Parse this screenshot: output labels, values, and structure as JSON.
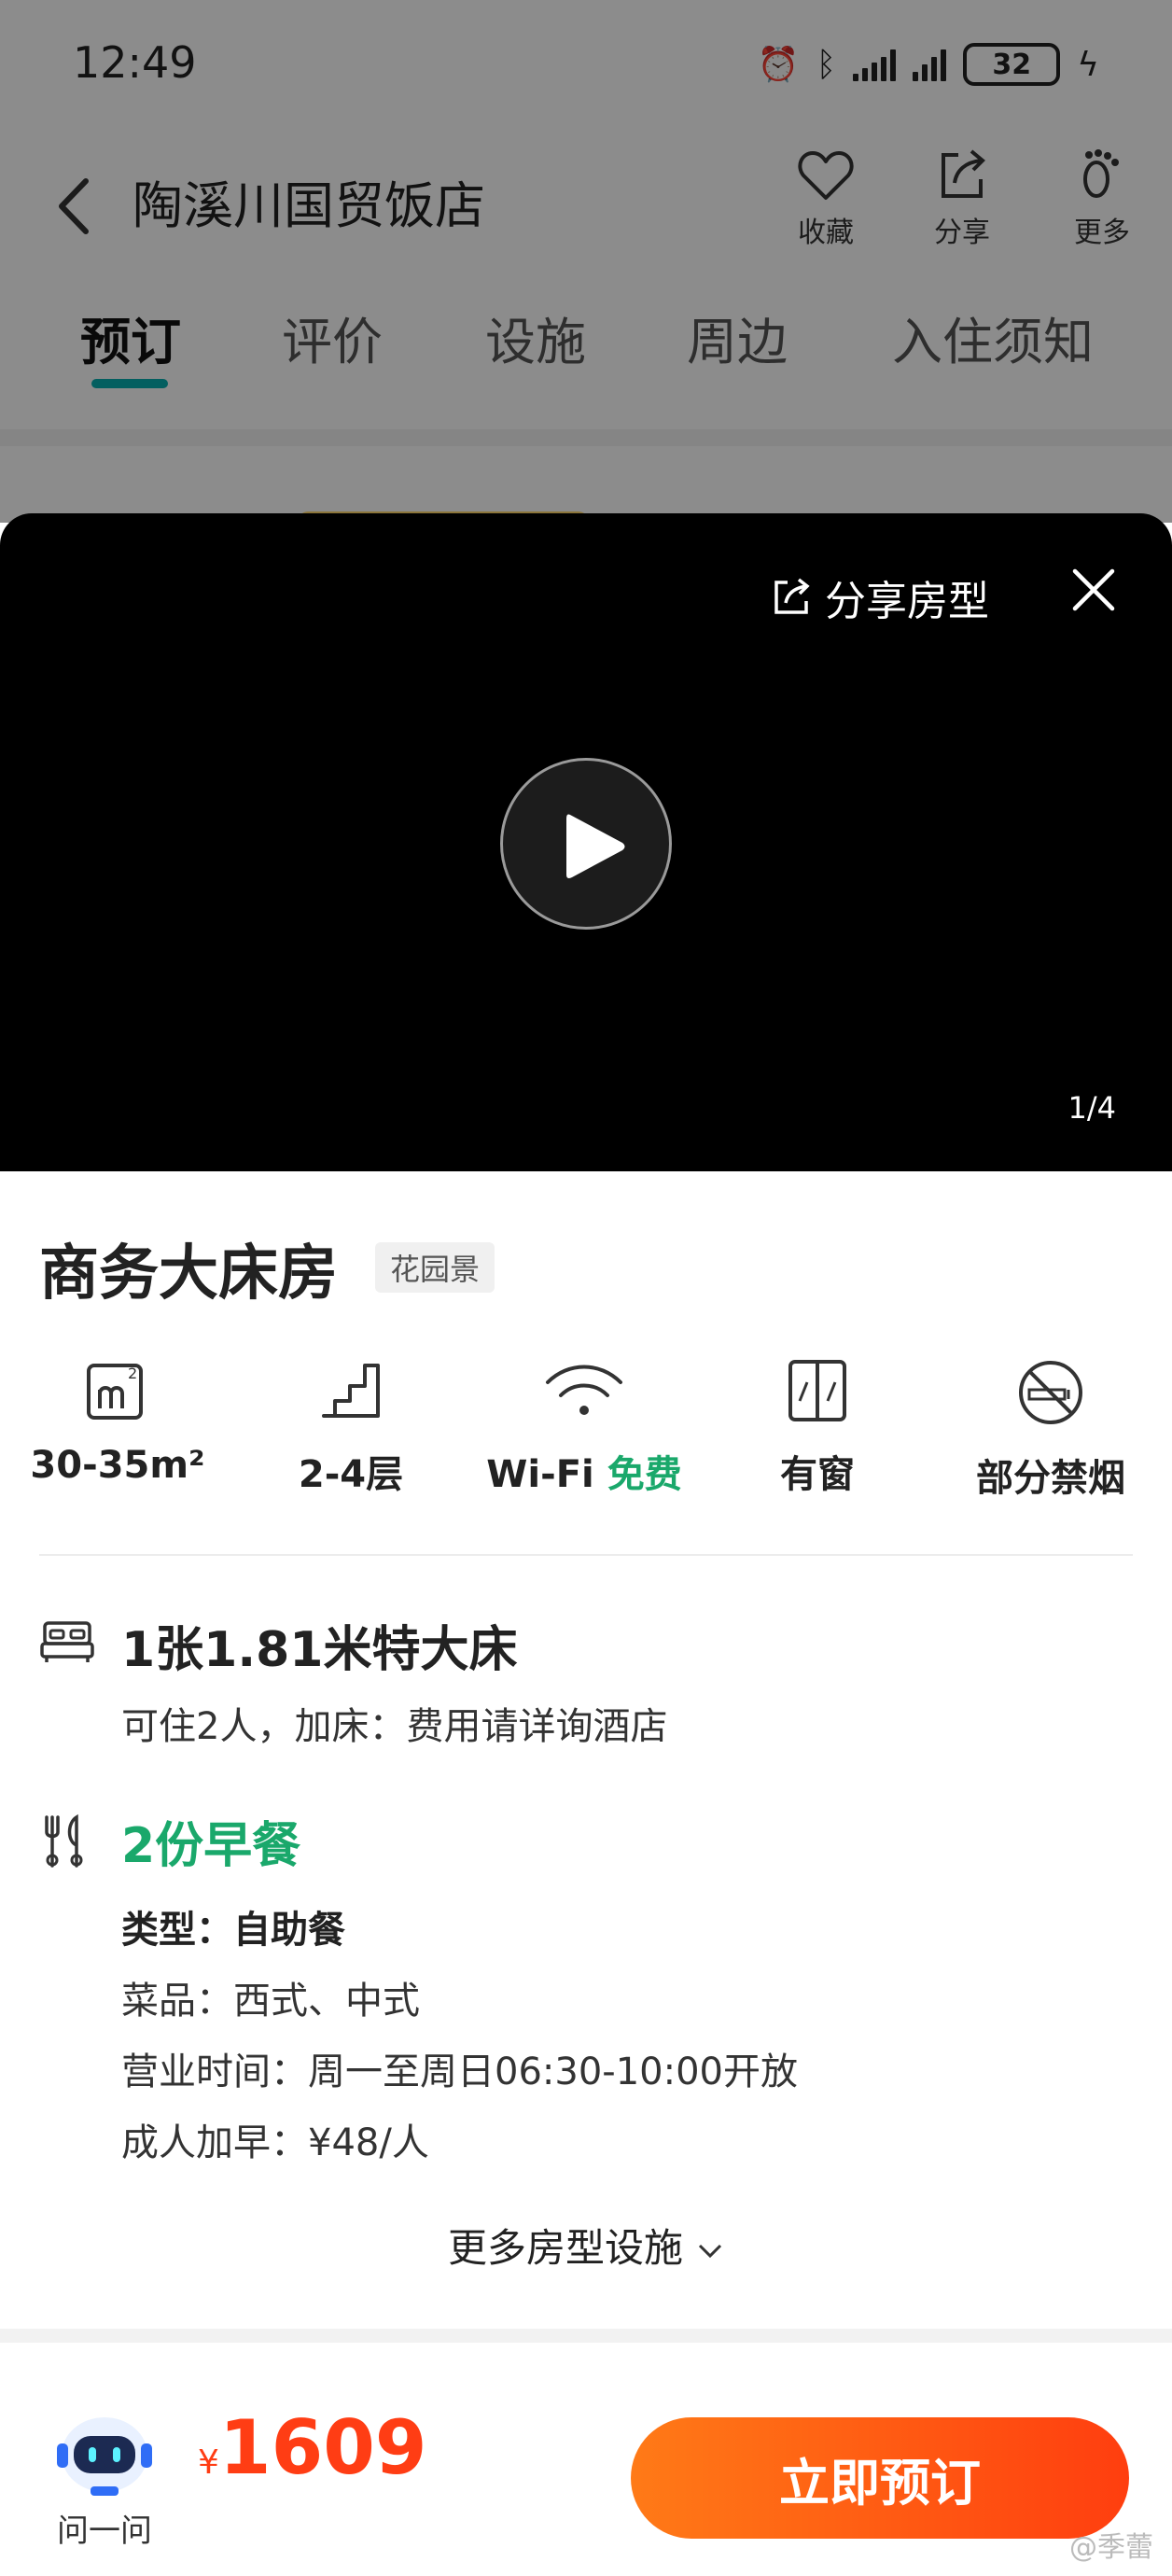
{
  "status_bar": {
    "time": "12:49",
    "battery": "32"
  },
  "header": {
    "title": "陶溪川国贸饭店",
    "actions": [
      {
        "label": "收藏",
        "icon": "heart-icon"
      },
      {
        "label": "分享",
        "icon": "share-icon"
      },
      {
        "label": "更多",
        "icon": "footprint-icon"
      }
    ]
  },
  "tabs": [
    {
      "label": "预订",
      "active": true
    },
    {
      "label": "评价",
      "active": false
    },
    {
      "label": "设施",
      "active": false
    },
    {
      "label": "周边",
      "active": false
    },
    {
      "label": "入住须知",
      "active": false
    }
  ],
  "media": {
    "share_label": "分享房型",
    "page_indicator": "1/4"
  },
  "room": {
    "name": "商务大床房",
    "view_tag": "花园景",
    "features": [
      {
        "label": "30-35m²",
        "icon": "area-icon"
      },
      {
        "label": "2-4层",
        "icon": "floor-stairs-icon"
      },
      {
        "label": "Wi-Fi",
        "extra": "免费",
        "icon": "wifi-icon"
      },
      {
        "label": "有窗",
        "icon": "window-icon"
      },
      {
        "label": "部分禁烟",
        "icon": "no-smoking-icon"
      }
    ],
    "bed": {
      "title": "1张1.81米特大床",
      "sub": "可住2人，加床：费用请详询酒店"
    },
    "breakfast": {
      "title": "2份早餐",
      "type_label": "类型：",
      "type_value": "自助餐",
      "cuisine": "菜品：西式、中式",
      "hours": "营业时间：周一至周日06:30-10:00开放",
      "extra": "成人加早：¥48/人"
    },
    "more_label": "更多房型设施"
  },
  "bottom": {
    "assistant_label": "问一问",
    "currency": "¥",
    "price": "1609",
    "book_label": "立即预订",
    "watermark": "@季蕾"
  },
  "colors": {
    "accent_teal": "#06aeb0",
    "green": "#1aa86b",
    "price_red": "#ff3d14",
    "button_orange": "#ff7a17"
  }
}
